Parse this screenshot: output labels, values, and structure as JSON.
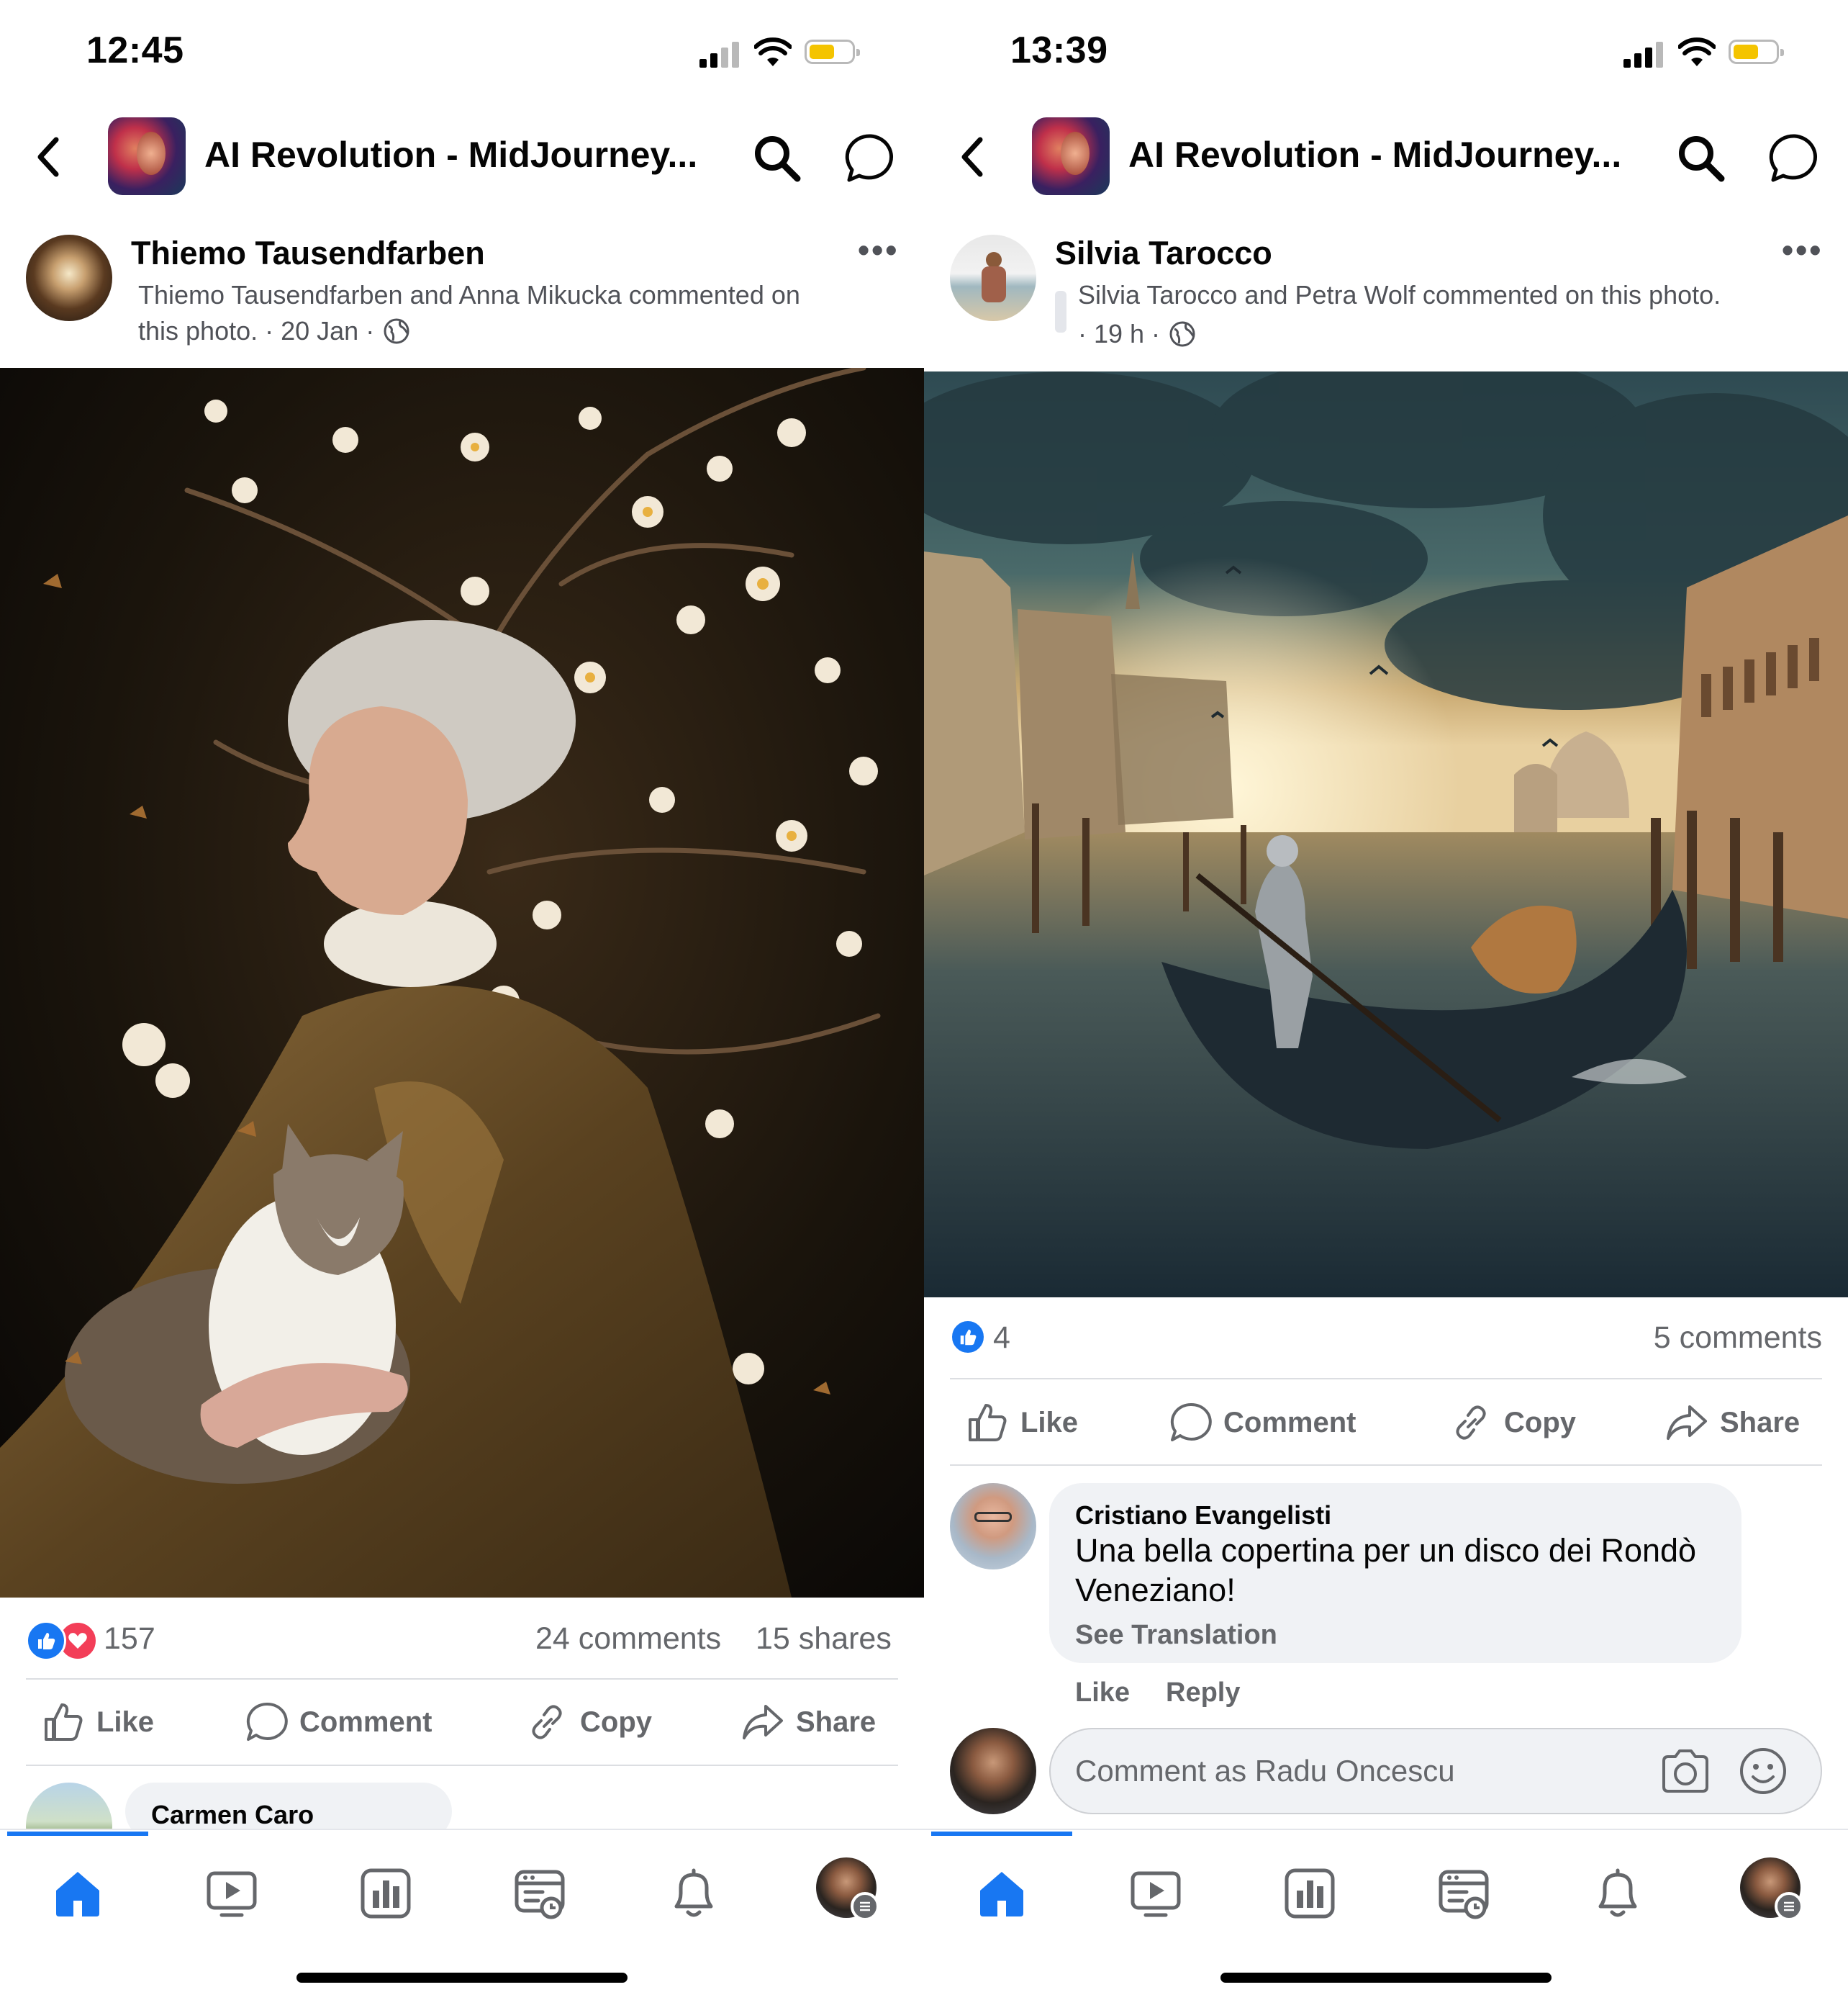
{
  "left": {
    "status_time": "12:45",
    "group_title": "AI Revolution - MidJourney...",
    "post": {
      "author": "Thiemo Tausendfarben",
      "meta_line1": "Thiemo Tausendfarben and Anna Mikucka commented on",
      "meta_line2": "this photo. · 20 Jan ·",
      "image_desc_icon": "photo-elderly-woman-with-cat-and-blossoms",
      "reactions": "157",
      "comments": "24 comments",
      "shares": "15 shares"
    },
    "actions": {
      "like": "Like",
      "comment": "Comment",
      "copy": "Copy",
      "share": "Share"
    },
    "partial_comment_author": "Carmen Caro"
  },
  "right": {
    "status_time": "13:39",
    "group_title": "AI Revolution - MidJourney...",
    "post": {
      "author": "Silvia Tarocco",
      "meta_line1": "Silvia Tarocco and Petra Wolf commented on this photo.",
      "meta_line2": "· 19 h ·",
      "image_desc_icon": "photo-venice-gondola-storm",
      "reactions": "4",
      "comments": "5 comments"
    },
    "actions": {
      "like": "Like",
      "comment": "Comment",
      "copy": "Copy",
      "share": "Share"
    },
    "comment": {
      "author": "Cristiano Evangelisti",
      "text_line1": "Una bella copertina per un disco dei Rondò",
      "text_line2": "Veneziano!",
      "see_translation": "See Translation",
      "like": "Like",
      "reply": "Reply"
    },
    "comment_input_placeholder": "Comment as Radu Oncescu"
  },
  "colors": {
    "accent": "#1877f2",
    "love": "#f33e58",
    "battery": "#f4c400"
  }
}
